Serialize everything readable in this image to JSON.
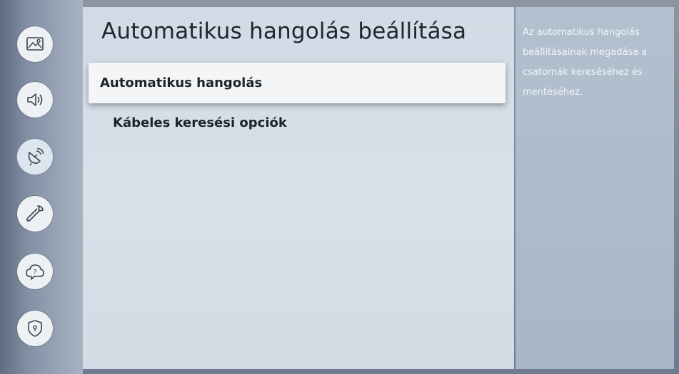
{
  "sidebar": {
    "items": [
      {
        "name": "picture",
        "icon": "picture-icon",
        "active": false
      },
      {
        "name": "sound",
        "icon": "speaker-icon",
        "active": false
      },
      {
        "name": "broadcasting",
        "icon": "satellite-dish-icon",
        "active": true
      },
      {
        "name": "general",
        "icon": "wrench-icon",
        "active": false
      },
      {
        "name": "support",
        "icon": "help-cloud-icon",
        "active": false
      },
      {
        "name": "privacy",
        "icon": "shield-icon",
        "active": false
      }
    ]
  },
  "main": {
    "title": "Automatikus hangolás beállítása",
    "menu": [
      {
        "label": "Automatikus hangolás",
        "focused": true
      },
      {
        "label": "Kábeles keresési opciók",
        "focused": false
      }
    ]
  },
  "help": {
    "text": "Az automatikus hangolás beállításainak megadása a csatornák kereséséhez és mentéséhez."
  },
  "colors": {
    "panel": "#d5dde6",
    "focus": "#f4f5f6",
    "help_bg": "#adbbca",
    "text": "#1d232b"
  }
}
